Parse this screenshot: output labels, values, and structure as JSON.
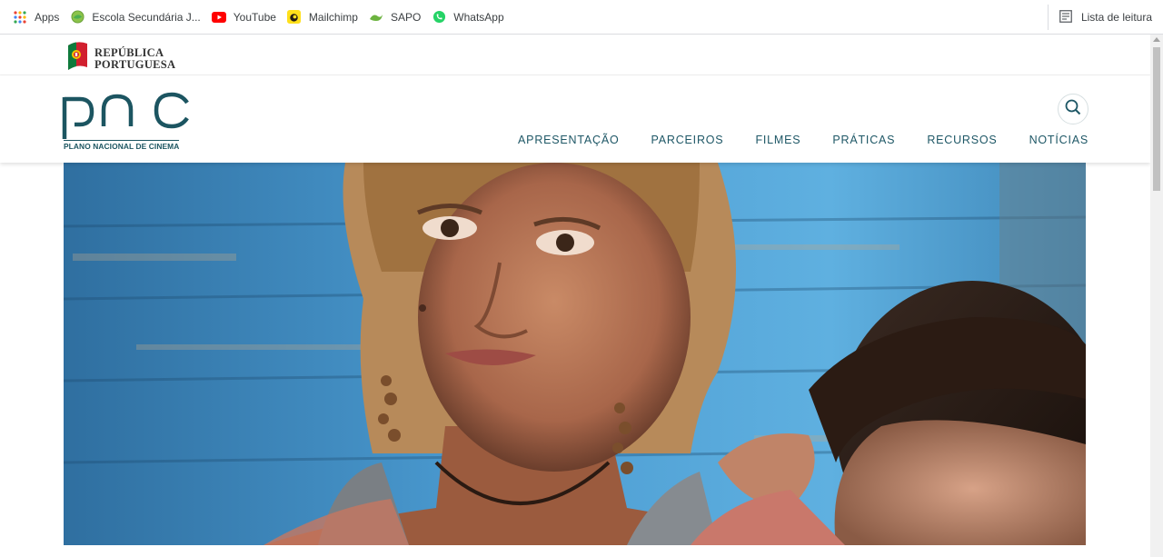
{
  "bookmarks_bar": {
    "items": [
      {
        "label": "Apps",
        "icon": "apps-grid-icon"
      },
      {
        "label": "Escola Secundária J...",
        "icon": "school-globe-icon"
      },
      {
        "label": "YouTube",
        "icon": "youtube-icon"
      },
      {
        "label": "Mailchimp",
        "icon": "mailchimp-icon"
      },
      {
        "label": "SAPO",
        "icon": "sapo-icon"
      },
      {
        "label": "WhatsApp",
        "icon": "whatsapp-icon"
      }
    ],
    "reading_list": {
      "label": "Lista de leitura",
      "icon": "reading-list-icon"
    }
  },
  "gov": {
    "line1": "REPÚBLICA",
    "line2": "PORTUGUESA",
    "icon": "portuguese-flag-icon"
  },
  "header": {
    "logo_text": "PNC",
    "logo_subtitle": "PLANO NACIONAL DE CINEMA",
    "nav": [
      "APRESENTAÇÃO",
      "PARCEIROS",
      "FILMES",
      "PRÁTICAS",
      "RECURSOS",
      "NOTÍCIAS"
    ],
    "search_icon": "search-icon"
  },
  "hero": {
    "image": "film-still-two-girls-photo"
  },
  "colors": {
    "brand_teal": "#1e5766",
    "logo_teal": "#1c5561",
    "bookmark_text": "#3c4043"
  }
}
